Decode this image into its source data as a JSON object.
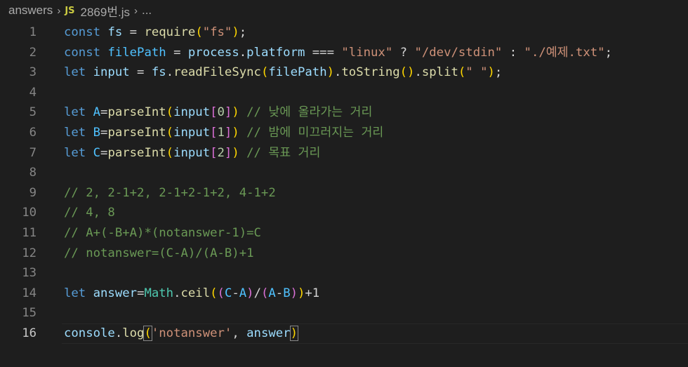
{
  "breadcrumb": {
    "folder": "answers",
    "lang_badge": "JS",
    "file": "2869번.js",
    "more": "..."
  },
  "lines": [
    {
      "no": "1"
    },
    {
      "no": "2"
    },
    {
      "no": "3"
    },
    {
      "no": "4"
    },
    {
      "no": "5"
    },
    {
      "no": "6"
    },
    {
      "no": "7"
    },
    {
      "no": "8"
    },
    {
      "no": "9"
    },
    {
      "no": "10"
    },
    {
      "no": "11"
    },
    {
      "no": "12"
    },
    {
      "no": "13"
    },
    {
      "no": "14"
    },
    {
      "no": "15"
    },
    {
      "no": "16"
    }
  ],
  "code": {
    "l1": {
      "kw": "const",
      "v": "fs",
      "eq": " = ",
      "fn": "require",
      "o": "(",
      "s": "\"fs\"",
      "c": ");"
    },
    "l2": {
      "kw": "const",
      "v": "filePath",
      "eq": " = ",
      "v2": "process",
      "dot": ".",
      "v3": "platform",
      "op": " === ",
      "s1": "\"linux\"",
      "q": " ? ",
      "s2": "\"/dev/stdin\"",
      "col": " : ",
      "s3": "\"./예제.txt\"",
      "end": ";"
    },
    "l3": {
      "kw": "let",
      "v": "input",
      "eq": " = ",
      "v2": "fs",
      "d1": ".",
      "f1": "readFileSync",
      "o1": "(",
      "v3": "filePath",
      "c1": ")",
      "d2": ".",
      "f2": "toString",
      "o2": "()",
      "d3": ".",
      "f3": "split",
      "o3": "(",
      "s": "\" \"",
      "c3": ");"
    },
    "l5": {
      "kw": "let",
      "v": "A",
      "eq": "=",
      "fn": "parseInt",
      "o": "(",
      "arg": "input",
      "bo": "[",
      "n": "0",
      "bc": "]",
      "c": ")",
      "cm": " // 낮에 올라가는 거리"
    },
    "l6": {
      "kw": "let",
      "v": "B",
      "eq": "=",
      "fn": "parseInt",
      "o": "(",
      "arg": "input",
      "bo": "[",
      "n": "1",
      "bc": "]",
      "c": ")",
      "cm": " // 밤에 미끄러지는 거리"
    },
    "l7": {
      "kw": "let",
      "v": "C",
      "eq": "=",
      "fn": "parseInt",
      "o": "(",
      "arg": "input",
      "bo": "[",
      "n": "2",
      "bc": "]",
      "c": ")",
      "cm": " // 목표 거리"
    },
    "l9": "// 2, 2-1+2, 2-1+2-1+2, 4-1+2",
    "l10": "// 4, 8",
    "l11": "// A+(-B+A)*(notanswer-1)=C",
    "l12": "// notanswer=(C-A)/(A-B)+1",
    "l14": {
      "kw": "let",
      "v": "answer",
      "eq": "=",
      "cls": "Math",
      "dot": ".",
      "fn": "ceil",
      "o1": "(",
      "o2": "(",
      "a": "C",
      "m1": "-",
      "b": "A",
      "c2": ")",
      "div": "/",
      "o3": "(",
      "a2": "A",
      "m2": "-",
      "b2": "B",
      "c3": ")",
      "c1": ")",
      "tail": "+1"
    },
    "l16": {
      "v": "console",
      "dot": ".",
      "fn": "log",
      "o": "(",
      "s": "'notanswer'",
      "comma": ", ",
      "v2": "answer",
      "c": ")"
    }
  }
}
